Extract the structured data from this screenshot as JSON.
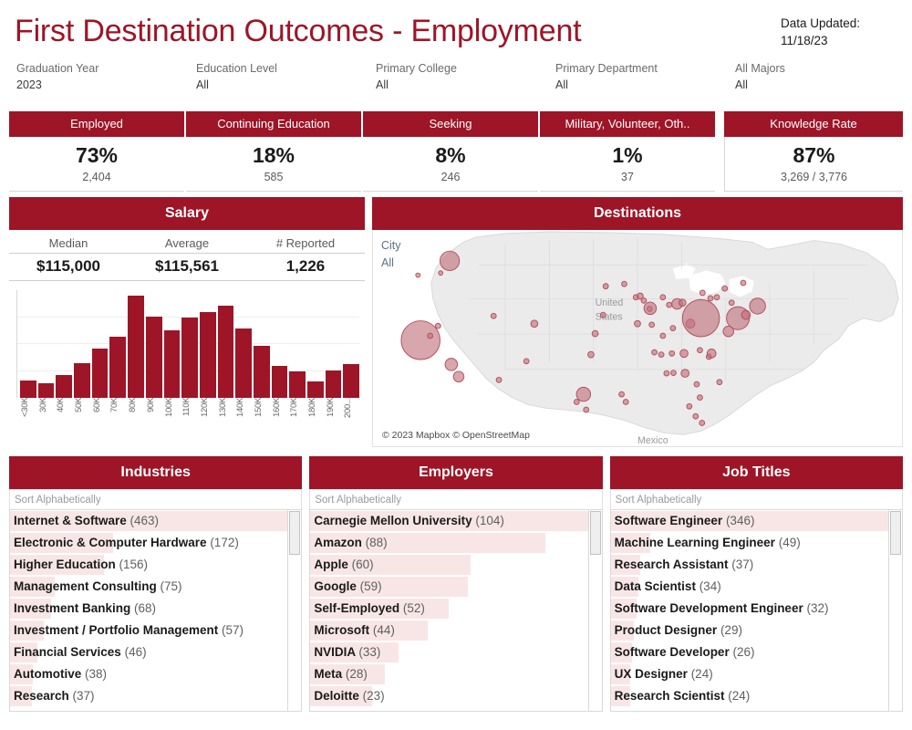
{
  "header": {
    "title": "First Destination Outcomes - Employment",
    "data_updated_label": "Data Updated:",
    "data_updated_value": "11/18/23",
    "filters": [
      {
        "label": "Graduation Year",
        "value": "2023"
      },
      {
        "label": "Education Level",
        "value": "All"
      },
      {
        "label": "Primary College",
        "value": "All"
      },
      {
        "label": "Primary Department",
        "value": "All"
      },
      {
        "label": "All Majors",
        "value": "All"
      }
    ]
  },
  "kpis": [
    {
      "title": "Employed",
      "value": "73%",
      "sub": "2,404"
    },
    {
      "title": "Continuing Education",
      "value": "18%",
      "sub": "585"
    },
    {
      "title": "Seeking",
      "value": "8%",
      "sub": "246"
    },
    {
      "title": "Military, Volunteer, Oth..",
      "value": "1%",
      "sub": "37"
    }
  ],
  "knowledge_rate": {
    "title": "Knowledge Rate",
    "value": "87%",
    "sub": "3,269 / 3,776"
  },
  "salary": {
    "panel_title": "Salary",
    "stats": [
      {
        "label": "Median",
        "value": "$115,000"
      },
      {
        "label": "Average",
        "value": "$115,561"
      },
      {
        "label": "# Reported",
        "value": "1,226"
      }
    ]
  },
  "destinations": {
    "panel_title": "Destinations",
    "city_label": "City",
    "city_value": "All",
    "attribution": "© 2023 Mapbox © OpenStreetMap",
    "map_labels": [
      "United",
      "States",
      "Mexico"
    ]
  },
  "industries": {
    "panel_title": "Industries",
    "sort_label": "Sort Alphabetically",
    "items": [
      {
        "label": "Internet & Software",
        "count": 463
      },
      {
        "label": "Electronic & Computer Hardware",
        "count": 172
      },
      {
        "label": "Higher Education",
        "count": 156
      },
      {
        "label": "Management Consulting",
        "count": 75
      },
      {
        "label": "Investment Banking",
        "count": 68
      },
      {
        "label": "Investment / Portfolio Management",
        "count": 57
      },
      {
        "label": "Financial Services",
        "count": 46
      },
      {
        "label": "Automotive",
        "count": 38
      },
      {
        "label": "Research",
        "count": 37
      }
    ]
  },
  "employers": {
    "panel_title": "Employers",
    "sort_label": "Sort Alphabetically",
    "items": [
      {
        "label": "Carnegie Mellon University",
        "count": 104
      },
      {
        "label": "Amazon",
        "count": 88
      },
      {
        "label": "Apple",
        "count": 60
      },
      {
        "label": "Google",
        "count": 59
      },
      {
        "label": "Self-Employed",
        "count": 52
      },
      {
        "label": "Microsoft",
        "count": 44
      },
      {
        "label": "NVIDIA",
        "count": 33
      },
      {
        "label": "Meta",
        "count": 28
      },
      {
        "label": "Deloitte",
        "count": 23
      }
    ]
  },
  "job_titles": {
    "panel_title": "Job Titles",
    "sort_label": "Sort Alphabetically",
    "items": [
      {
        "label": "Software Engineer",
        "count": 346
      },
      {
        "label": "Machine Learning Engineer",
        "count": 49
      },
      {
        "label": "Research Assistant",
        "count": 37
      },
      {
        "label": "Data Scientist",
        "count": 34
      },
      {
        "label": "Software Development Engineer",
        "count": 32
      },
      {
        "label": "Product Designer",
        "count": 29
      },
      {
        "label": "Software Developer",
        "count": 26
      },
      {
        "label": "UX Designer",
        "count": 24
      },
      {
        "label": "Research Scientist",
        "count": 24
      }
    ]
  },
  "colors": {
    "brand_red": "#9d1527",
    "highlight_pink": "#f8e6e6",
    "map_land": "#ebebeb",
    "map_dot": "#c0707a"
  },
  "chart_data": {
    "type": "bar",
    "title": "Salary",
    "xlabel": "",
    "ylabel": "",
    "grid": true,
    "categories": [
      "<30K",
      "30K",
      "40K",
      "50K",
      "60K",
      "70K",
      "80K",
      "90K",
      "100K",
      "110K",
      "120K",
      "130K",
      "140K",
      "150K",
      "160K",
      "170K",
      "180K",
      "190K",
      "200..."
    ],
    "values": [
      17,
      14,
      22,
      34,
      48,
      60,
      100,
      79,
      66,
      78,
      84,
      90,
      68,
      51,
      31,
      26,
      16,
      27,
      33
    ],
    "ylim": [
      0,
      105
    ]
  },
  "map_points": [
    {
      "x": 0.145,
      "y": 0.14,
      "r": 11
    },
    {
      "x": 0.085,
      "y": 0.205,
      "r": 2.5
    },
    {
      "x": 0.128,
      "y": 0.195,
      "r": 2.5
    },
    {
      "x": 0.09,
      "y": 0.5,
      "r": 22
    },
    {
      "x": 0.123,
      "y": 0.435,
      "r": 3
    },
    {
      "x": 0.108,
      "y": 0.48,
      "r": 3
    },
    {
      "x": 0.148,
      "y": 0.61,
      "r": 7
    },
    {
      "x": 0.162,
      "y": 0.665,
      "r": 6
    },
    {
      "x": 0.228,
      "y": 0.39,
      "r": 3
    },
    {
      "x": 0.238,
      "y": 0.68,
      "r": 3
    },
    {
      "x": 0.29,
      "y": 0.595,
      "r": 3
    },
    {
      "x": 0.305,
      "y": 0.425,
      "r": 4
    },
    {
      "x": 0.42,
      "y": 0.47,
      "r": 3.5
    },
    {
      "x": 0.435,
      "y": 0.385,
      "r": 3
    },
    {
      "x": 0.44,
      "y": 0.255,
      "r": 3
    },
    {
      "x": 0.412,
      "y": 0.565,
      "r": 3.5
    },
    {
      "x": 0.398,
      "y": 0.745,
      "r": 8
    },
    {
      "x": 0.385,
      "y": 0.78,
      "r": 3
    },
    {
      "x": 0.403,
      "y": 0.815,
      "r": 3
    },
    {
      "x": 0.47,
      "y": 0.745,
      "r": 3
    },
    {
      "x": 0.478,
      "y": 0.78,
      "r": 3
    },
    {
      "x": 0.497,
      "y": 0.305,
      "r": 3
    },
    {
      "x": 0.505,
      "y": 0.3,
      "r": 3.5
    },
    {
      "x": 0.512,
      "y": 0.32,
      "r": 3
    },
    {
      "x": 0.5,
      "y": 0.425,
      "r": 3.5
    },
    {
      "x": 0.523,
      "y": 0.358,
      "r": 3
    },
    {
      "x": 0.527,
      "y": 0.43,
      "r": 3
    },
    {
      "x": 0.524,
      "y": 0.355,
      "r": 7
    },
    {
      "x": 0.548,
      "y": 0.305,
      "r": 3
    },
    {
      "x": 0.56,
      "y": 0.34,
      "r": 3
    },
    {
      "x": 0.548,
      "y": 0.48,
      "r": 3
    },
    {
      "x": 0.567,
      "y": 0.445,
      "r": 3
    },
    {
      "x": 0.575,
      "y": 0.335,
      "r": 6
    },
    {
      "x": 0.585,
      "y": 0.33,
      "r": 4
    },
    {
      "x": 0.532,
      "y": 0.555,
      "r": 3
    },
    {
      "x": 0.545,
      "y": 0.565,
      "r": 3
    },
    {
      "x": 0.555,
      "y": 0.65,
      "r": 3
    },
    {
      "x": 0.568,
      "y": 0.648,
      "r": 3
    },
    {
      "x": 0.565,
      "y": 0.56,
      "r": 3
    },
    {
      "x": 0.588,
      "y": 0.56,
      "r": 4.5
    },
    {
      "x": 0.59,
      "y": 0.65,
      "r": 4.5
    },
    {
      "x": 0.6,
      "y": 0.425,
      "r": 5
    },
    {
      "x": 0.62,
      "y": 0.4,
      "r": 21
    },
    {
      "x": 0.623,
      "y": 0.285,
      "r": 3
    },
    {
      "x": 0.638,
      "y": 0.31,
      "r": 3
    },
    {
      "x": 0.65,
      "y": 0.305,
      "r": 3
    },
    {
      "x": 0.665,
      "y": 0.265,
      "r": 3
    },
    {
      "x": 0.678,
      "y": 0.33,
      "r": 3
    },
    {
      "x": 0.672,
      "y": 0.46,
      "r": 6
    },
    {
      "x": 0.69,
      "y": 0.4,
      "r": 13
    },
    {
      "x": 0.705,
      "y": 0.385,
      "r": 5
    },
    {
      "x": 0.7,
      "y": 0.24,
      "r": 3
    },
    {
      "x": 0.727,
      "y": 0.345,
      "r": 9
    },
    {
      "x": 0.618,
      "y": 0.545,
      "r": 3
    },
    {
      "x": 0.635,
      "y": 0.575,
      "r": 3
    },
    {
      "x": 0.64,
      "y": 0.56,
      "r": 5
    },
    {
      "x": 0.655,
      "y": 0.69,
      "r": 3
    },
    {
      "x": 0.612,
      "y": 0.7,
      "r": 3
    },
    {
      "x": 0.598,
      "y": 0.8,
      "r": 3
    },
    {
      "x": 0.61,
      "y": 0.845,
      "r": 3
    },
    {
      "x": 0.622,
      "y": 0.875,
      "r": 3
    },
    {
      "x": 0.618,
      "y": 0.76,
      "r": 3
    },
    {
      "x": 0.475,
      "y": 0.245,
      "r": 3
    }
  ]
}
